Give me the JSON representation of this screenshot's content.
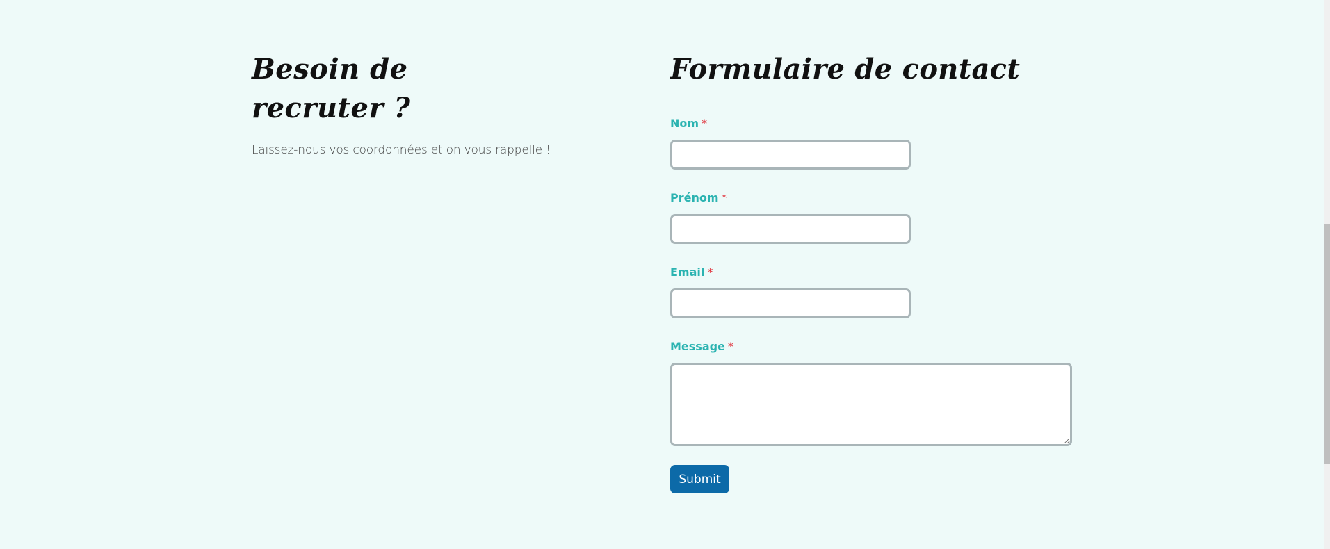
{
  "left": {
    "title_line1": "Besoin de",
    "title_line2": "recruter ?",
    "intro": "Laissez-nous vos coordonnées et on vous rappelle !"
  },
  "form": {
    "title": "Formulaire de contact",
    "required_marker": "*",
    "fields": [
      {
        "label": "Nom",
        "value": "",
        "placeholder": ""
      },
      {
        "label": "Prénom",
        "value": "",
        "placeholder": ""
      },
      {
        "label": "Email",
        "value": "",
        "placeholder": ""
      },
      {
        "label": "Message",
        "value": "",
        "placeholder": ""
      }
    ],
    "submit_label": "Submit"
  },
  "colors": {
    "background": "#eefaf9",
    "label": "#2bb3b1",
    "required": "#e0303a",
    "button": "#0c6aa8",
    "input_border": "#a9b5b8"
  }
}
